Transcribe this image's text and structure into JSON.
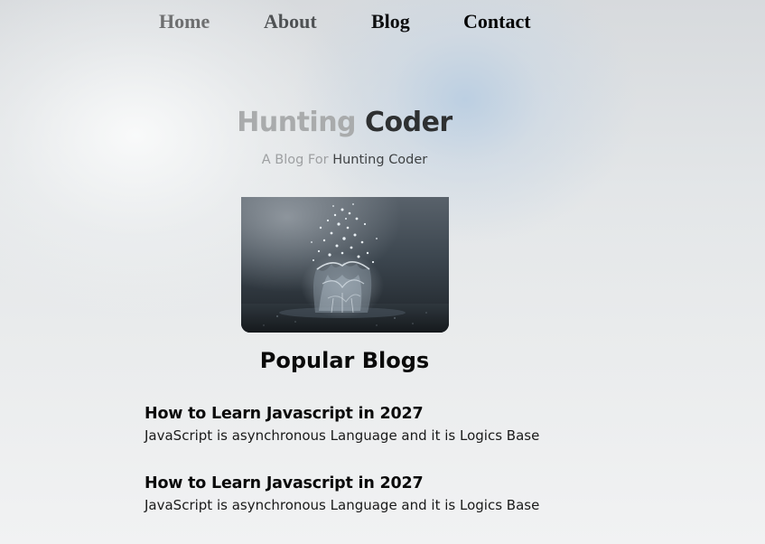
{
  "nav": {
    "items": [
      {
        "label": "Home"
      },
      {
        "label": "About"
      },
      {
        "label": "Blog"
      },
      {
        "label": "Contact"
      }
    ]
  },
  "hero": {
    "title_part1": "Hunting",
    "title_part2": "Coder",
    "subtitle_part1": "A Blog For",
    "subtitle_part2": "Hunting Coder",
    "image_subject": "water-splash-image"
  },
  "popular": {
    "heading": "Popular Blogs",
    "posts": [
      {
        "title": "How to Learn Javascript in 2027",
        "excerpt": "JavaScript is asynchronous Language and it is Logics Base"
      },
      {
        "title": "How to Learn Javascript in 2027",
        "excerpt": "JavaScript is asynchronous Language and it is Logics Base"
      }
    ]
  },
  "colors": {
    "nav_home": "#6e6f70",
    "nav_about": "#4f5254",
    "nav_blog": "#0e0f10",
    "nav_contact": "#060606",
    "title_light": "#a9abac",
    "title_dark": "#2e3031",
    "text_primary": "#0a0a0a"
  }
}
